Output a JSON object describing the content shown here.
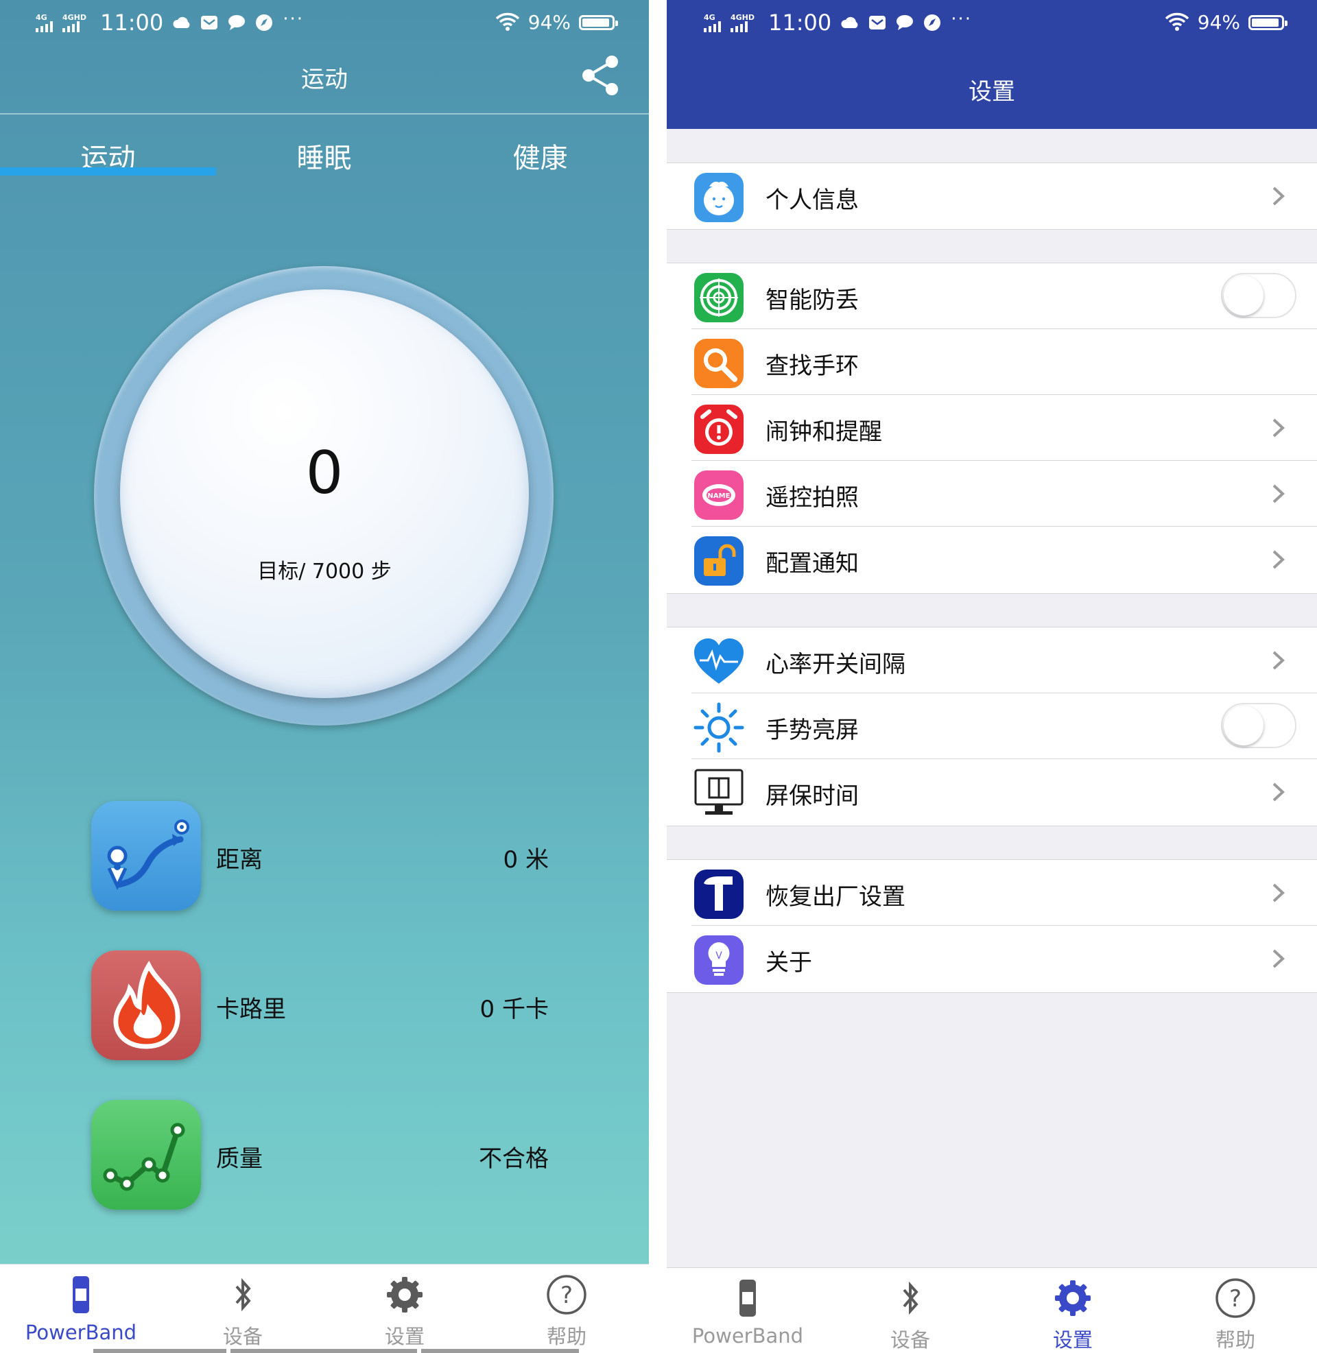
{
  "status_bar": {
    "signal1": "4G",
    "signal2": "4GHD",
    "time": "11:00",
    "battery": "94%",
    "notification_icons": [
      "cloud-icon",
      "mail-icon",
      "chat-icon",
      "compass-icon"
    ],
    "more": "···"
  },
  "left_screen": {
    "title": "运动",
    "tabs": [
      {
        "label": "运动",
        "active": true
      },
      {
        "label": "睡眠",
        "active": false
      },
      {
        "label": "健康",
        "active": false
      }
    ],
    "steps": "0",
    "goal": "目标/ 7000 步",
    "stats": [
      {
        "label": "距离",
        "value": "0 米",
        "icon": "route-icon"
      },
      {
        "label": "卡路里",
        "value": "0 千卡",
        "icon": "flame-icon"
      },
      {
        "label": "质量",
        "value": "不合格",
        "icon": "trend-icon"
      }
    ],
    "nav": [
      {
        "label": "PowerBand",
        "icon": "band-icon",
        "active": true
      },
      {
        "label": "设备",
        "icon": "bluetooth-icon",
        "active": false
      },
      {
        "label": "设置",
        "icon": "gear-icon",
        "active": false
      },
      {
        "label": "帮助",
        "icon": "help-icon",
        "active": false
      }
    ]
  },
  "right_screen": {
    "title": "设置",
    "groups": [
      [
        {
          "label": "个人信息",
          "icon": "profile-icon",
          "control": "chevron"
        }
      ],
      [
        {
          "label": "智能防丢",
          "icon": "target-icon",
          "control": "toggle",
          "on": false
        },
        {
          "label": "查找手环",
          "icon": "search-icon",
          "control": "none"
        },
        {
          "label": "闹钟和提醒",
          "icon": "alarm-icon",
          "control": "chevron"
        },
        {
          "label": "遥控拍照",
          "icon": "camera-remote-icon",
          "control": "chevron",
          "icon_text": "NAME"
        },
        {
          "label": "配置通知",
          "icon": "lock-icon",
          "control": "chevron"
        }
      ],
      [
        {
          "label": "心率开关间隔",
          "icon": "heart-rate-icon",
          "control": "chevron"
        },
        {
          "label": "手势亮屏",
          "icon": "sun-icon",
          "control": "toggle",
          "on": false
        },
        {
          "label": "屏保时间",
          "icon": "screen-icon",
          "control": "chevron"
        }
      ],
      [
        {
          "label": "恢复出厂设置",
          "icon": "hammer-icon",
          "control": "chevron"
        },
        {
          "label": "关于",
          "icon": "bulb-icon",
          "control": "chevron",
          "icon_text": "V"
        }
      ]
    ],
    "nav": [
      {
        "label": "PowerBand",
        "icon": "band-icon",
        "active": false
      },
      {
        "label": "设备",
        "icon": "bluetooth-icon",
        "active": false
      },
      {
        "label": "设置",
        "icon": "gear-icon",
        "active": true
      },
      {
        "label": "帮助",
        "icon": "help-icon",
        "active": false
      }
    ]
  },
  "colors": {
    "left_accent": "#27a3ea",
    "right_header": "#2d44a5",
    "nav_active": "#3949c7",
    "nav_inactive": "#9a9a9a"
  }
}
